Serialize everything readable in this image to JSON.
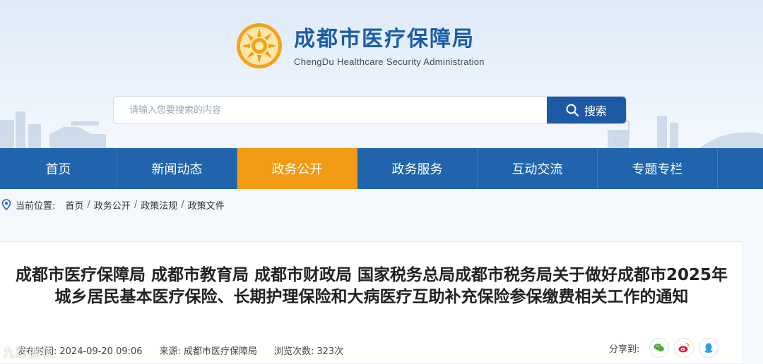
{
  "header": {
    "title_cn": "成都市医疗保障局",
    "title_en": "ChengDu Healthcare Security Administration"
  },
  "search": {
    "placeholder": "请输入您要搜索的内容",
    "button_label": "搜索"
  },
  "nav": {
    "items": [
      {
        "label": "首页",
        "active": false
      },
      {
        "label": "新闻动态",
        "active": false
      },
      {
        "label": "政务公开",
        "active": true
      },
      {
        "label": "政务服务",
        "active": false
      },
      {
        "label": "互动交流",
        "active": false
      },
      {
        "label": "专题专栏",
        "active": false
      }
    ],
    "active_color": "#f29b12",
    "bar_color": "#1f64ac"
  },
  "breadcrumb": {
    "label": "当前位置:",
    "items": [
      "首页",
      "政务公开",
      "政策法规",
      "政策文件"
    ]
  },
  "article": {
    "title": "成都市医疗保障局 成都市教育局 成都市财政局 国家税务总局成都市税务局关于做好成都市2025年城乡居民基本医疗保险、长期护理保险和大病医疗互助补充保险参保缴费相关工作的通知",
    "publish_label": "发布时间:",
    "publish_time": "2024-09-20 09:06",
    "source_label": "来源:",
    "source": "成都市医疗保障局",
    "views_label": "浏览次数:",
    "views": "323次",
    "share_label": "分享到:"
  },
  "share_icons": [
    "wechat-icon",
    "weibo-icon",
    "qq-icon"
  ],
  "watermark": "九数据统"
}
